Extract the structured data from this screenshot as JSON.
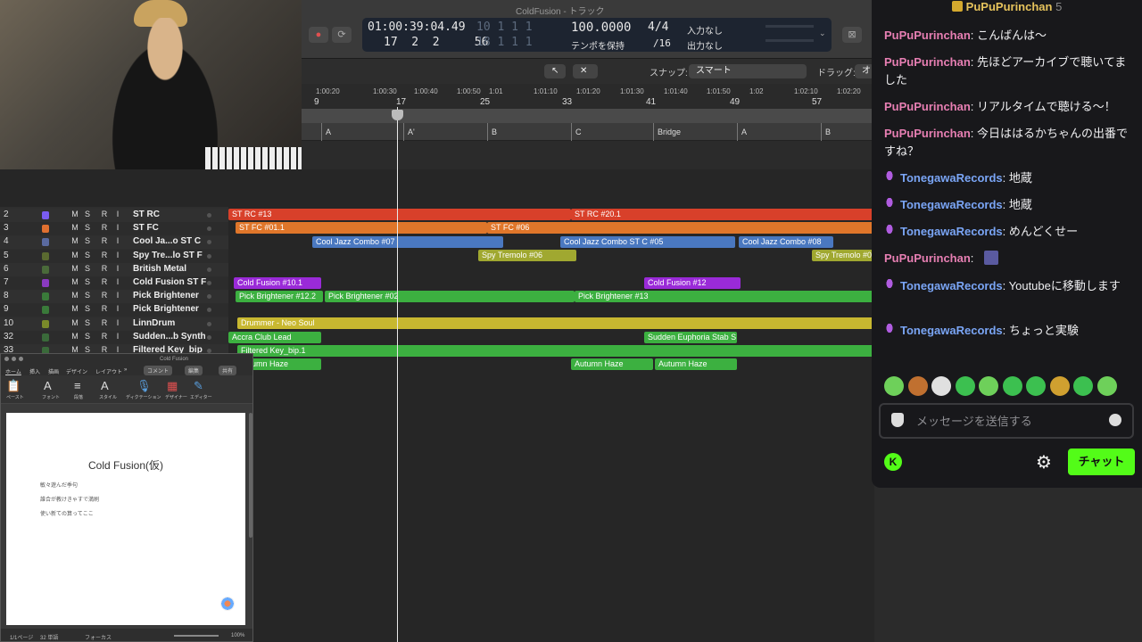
{
  "daw": {
    "window_title": "ColdFusion - トラック",
    "lcd": {
      "time": "01:00:39:04.49",
      "bars": "17  2  2     56",
      "sub_top": "10  1  1     1",
      "sub_bot": "18  1  1     1",
      "tempo": "100.0000",
      "tempo_label": "テンポを保持",
      "sig": "4/4",
      "div": "/16",
      "in_label": "入力なし",
      "out_label": "出力なし"
    },
    "snap_label": "スナップ:",
    "snap_value": "スマート",
    "drag_label": "ドラッグ:",
    "drag_value": "オ",
    "ruler_times": [
      "1:00:20",
      "1:00:30",
      "1:00:40",
      "1:00:50",
      "1:01",
      "1:01:10",
      "1:01:20",
      "1:01:30",
      "1:01:40",
      "1:01:50",
      "1:02",
      "1:02:10",
      "1:02:20"
    ],
    "ruler_bars": [
      "9",
      "17",
      "25",
      "33",
      "41",
      "49",
      "57"
    ],
    "markers": [
      "A",
      "A'",
      "B",
      "C",
      "Bridge",
      "A",
      "B"
    ],
    "master_track_number": "1",
    "tracks": [
      {
        "num": "2",
        "name": "ST RC",
        "icon": "#7a5cf0"
      },
      {
        "num": "3",
        "name": "ST FC",
        "icon": "#e07030"
      },
      {
        "num": "4",
        "name": "Cool Ja...o ST C",
        "icon": "#5a6aa0"
      },
      {
        "num": "5",
        "name": "Spy Tre...lo ST F",
        "icon": "#5a6a30"
      },
      {
        "num": "6",
        "name": "British Metal",
        "icon": "#4a6a3a"
      },
      {
        "num": "7",
        "name": "Cold Fusion ST F",
        "icon": "#8a3ac0"
      },
      {
        "num": "8",
        "name": "Pick Brightener",
        "icon": "#3a7a3a"
      },
      {
        "num": "9",
        "name": "Pick Brightener",
        "icon": "#3a7a3a"
      },
      {
        "num": "10",
        "name": "LinnDrum",
        "icon": "#7a8a2a"
      },
      {
        "num": "32",
        "name": "Sudden...b Synth",
        "icon": "#3a6a3a"
      },
      {
        "num": "33",
        "name": "Filtered Key_bip",
        "icon": "#3a6a3a"
      }
    ],
    "msri": [
      "M",
      "S",
      "R",
      "I"
    ],
    "regions": {
      "r1": "ST RC #13",
      "r2": "ST RC #20.1",
      "r3": "ST FC #01.1",
      "r4": "ST FC #06",
      "r5": "Cool Jazz Combo #07",
      "r6": "Cool Jazz Combo ST C #05",
      "r7": "Cool Jazz Combo #08",
      "r8": "Spy Tremolo #06",
      "r9": "Spy Tremolo #0",
      "r10": "Cold Fusion #10.1",
      "r11": "Cold Fusion #12",
      "r12": "Pick Brightener #12.2",
      "r13": "Pick Brightener #02",
      "r14": "Pick Brightener #13",
      "r15": "Drummer - Neo Soul",
      "r16": "Accra Club Lead",
      "r17": "Sudden Euphoria Stab S",
      "r18": "Filtered Key_bip.1",
      "r19": "umn Haze",
      "r20": "Autumn Haze",
      "r21": "Autumn Haze"
    }
  },
  "word": {
    "title": "Cold Fusion",
    "tabs": [
      "ホーム",
      "挿入",
      "描画",
      "デザイン",
      "レイアウト",
      "»"
    ],
    "comment_btn": "コメント",
    "edit_btn": "編集",
    "share_btn": "共有",
    "ribbon": [
      "ペースト",
      "フォント",
      "段落",
      "スタイル",
      "ディクテーション",
      "デザイナー",
      "エディター"
    ],
    "doc_title": "Cold Fusion(仮)",
    "doc_lines": [
      "敏々遊んだ季句",
      "誰合が教けきゃすで満刷",
      "使い新ての算ってここ"
    ],
    "status": [
      "1/1ページ",
      "32 単語",
      "フォーカス",
      "100%"
    ]
  },
  "chat": {
    "header_user": "PuPuPurinchan",
    "header_badge": "5",
    "messages": [
      {
        "user": "PuPuPurinchan",
        "color": "pink",
        "mic": false,
        "text": "こんばんは〜"
      },
      {
        "user": "PuPuPurinchan",
        "color": "pink",
        "mic": false,
        "text": "先ほどアーカイブで聴いてました"
      },
      {
        "user": "PuPuPurinchan",
        "color": "pink",
        "mic": false,
        "text": "リアルタイムで聴ける〜！"
      },
      {
        "user": "PuPuPurinchan",
        "color": "pink",
        "mic": false,
        "text": "今日ははるかちゃんの出番ですね？"
      },
      {
        "user": "TonegawaRecords",
        "color": "blue",
        "mic": true,
        "text": "地蔵"
      },
      {
        "user": "TonegawaRecords",
        "color": "blue",
        "mic": true,
        "text": "地蔵"
      },
      {
        "user": "TonegawaRecords",
        "color": "blue",
        "mic": true,
        "text": "めんどくせー"
      },
      {
        "user": "PuPuPurinchan",
        "color": "pink",
        "mic": false,
        "text": ""
      },
      {
        "user": "TonegawaRecords",
        "color": "blue",
        "mic": true,
        "text": "Youtubeに移動します"
      },
      {
        "user": "TonegawaRecords",
        "color": "blue",
        "mic": true,
        "text": "ちょっと実験"
      }
    ],
    "input_placeholder": "メッセージを送信する",
    "send_label": "チャット",
    "emotes": [
      "emote-1",
      "emote-2",
      "emote-3",
      "emote-4",
      "emote-5",
      "emote-6",
      "emote-7",
      "emote-8",
      "emote-9",
      "emote-10"
    ]
  }
}
